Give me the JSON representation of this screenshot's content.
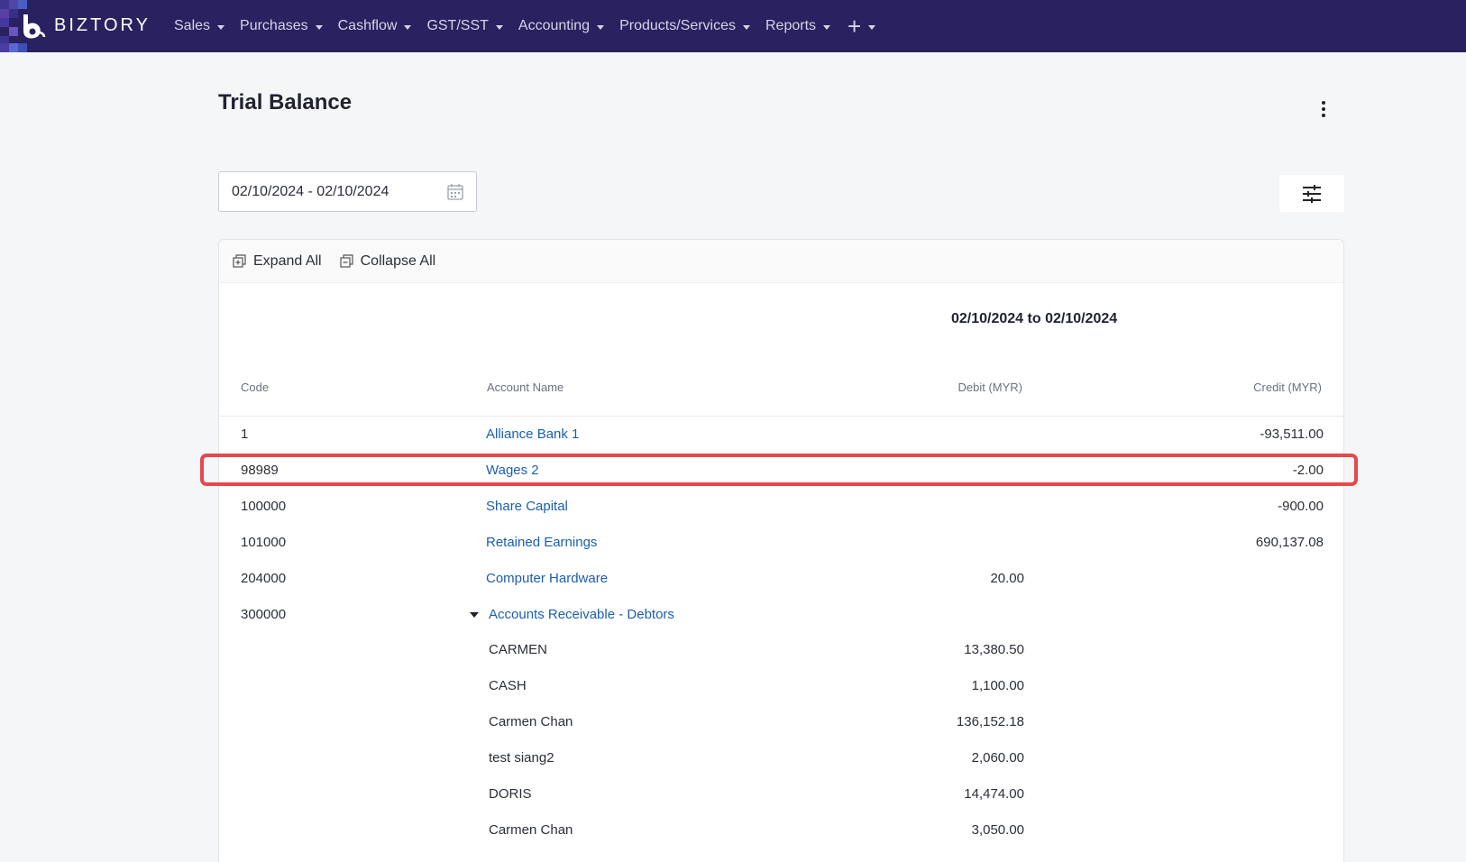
{
  "app": {
    "brand": "BIZTORY",
    "brand_color": "#2a2160"
  },
  "nav": {
    "items": [
      "Sales",
      "Purchases",
      "Cashflow",
      "GST/SST",
      "Accounting",
      "Products/Services",
      "Reports"
    ],
    "plus": "+"
  },
  "page": {
    "title": "Trial Balance",
    "date_range": "02/10/2024 - 02/10/2024"
  },
  "toolbar": {
    "expand_all": "Expand All",
    "collapse_all": "Collapse All"
  },
  "report": {
    "period": "02/10/2024 to 02/10/2024",
    "columns": {
      "code": "Code",
      "account": "Account Name",
      "debit": "Debit (MYR)",
      "credit": "Credit (MYR)"
    },
    "rows": [
      {
        "code": "1",
        "account": "Alliance Bank 1",
        "debit": "",
        "credit": "-93,511.00"
      },
      {
        "code": "98989",
        "account": "Wages 2",
        "debit": "",
        "credit": "-2.00"
      },
      {
        "code": "100000",
        "account": "Share Capital",
        "debit": "",
        "credit": "-900.00"
      },
      {
        "code": "101000",
        "account": "Retained Earnings",
        "debit": "",
        "credit": "690,137.08"
      },
      {
        "code": "204000",
        "account": "Computer Hardware",
        "debit": "20.00",
        "credit": ""
      },
      {
        "code": "300000",
        "account": "Accounts Receivable - Debtors",
        "debit": "",
        "credit": ""
      }
    ],
    "sub_rows": [
      {
        "name": "CARMEN",
        "debit": "13,380.50"
      },
      {
        "name": "CASH",
        "debit": "1,100.00"
      },
      {
        "name": "Carmen Chan",
        "debit": "136,152.18"
      },
      {
        "name": "test siang2",
        "debit": "2,060.00"
      },
      {
        "name": "DORIS",
        "debit": "14,474.00"
      },
      {
        "name": "Carmen Chan",
        "debit": "3,050.00"
      }
    ]
  },
  "colors": {
    "link": "#1b5fae",
    "highlight": "#e5484d"
  }
}
